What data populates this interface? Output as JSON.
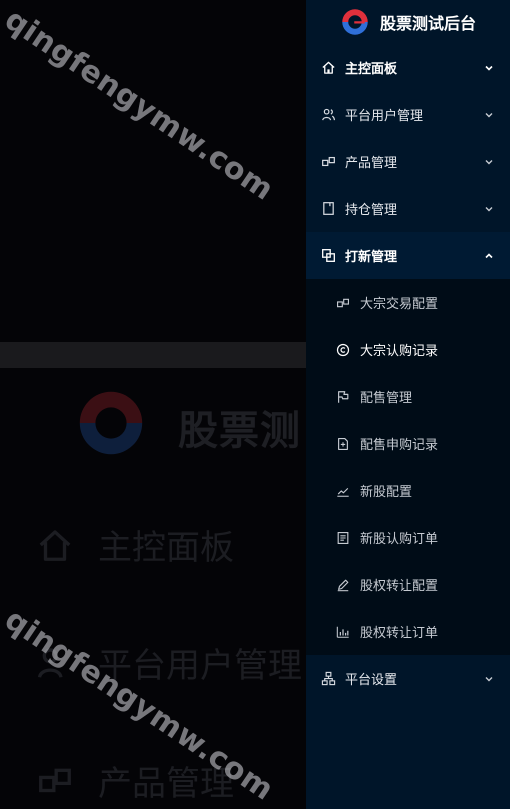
{
  "watermark": {
    "text1": "qingfengymw.com",
    "text2": "qingfengymw.com"
  },
  "background": {
    "title": "股票测",
    "items": [
      "主控面板",
      "平台用户管理",
      "产品管理"
    ]
  },
  "brand": {
    "title": "股票测试后台"
  },
  "menu": [
    {
      "label": "主控面板",
      "icon": "home-icon",
      "expanded": false
    },
    {
      "label": "平台用户管理",
      "icon": "users-icon",
      "expanded": false
    },
    {
      "label": "产品管理",
      "icon": "product-icon",
      "expanded": false
    },
    {
      "label": "持仓管理",
      "icon": "document-icon",
      "expanded": false
    },
    {
      "label": "打新管理",
      "icon": "ipo-icon",
      "expanded": true
    }
  ],
  "submenu": [
    {
      "label": "大宗交易配置",
      "icon": "product-icon"
    },
    {
      "label": "大宗认购记录",
      "icon": "copyright-icon",
      "active": true
    },
    {
      "label": "配售管理",
      "icon": "flag-icon"
    },
    {
      "label": "配售申购记录",
      "icon": "file-icon"
    },
    {
      "label": "新股配置",
      "icon": "line-chart-icon"
    },
    {
      "label": "新股认购订单",
      "icon": "receipt-icon"
    },
    {
      "label": "股权转让配置",
      "icon": "edit-icon"
    },
    {
      "label": "股权转让订单",
      "icon": "bar-chart-icon"
    }
  ],
  "bottom_menu": {
    "label": "平台设置",
    "icon": "cluster-icon",
    "expanded": false
  },
  "colors": {
    "sidebar_bg": "#001529",
    "submenu_bg": "#000c17",
    "logo_red": "#e0303c",
    "logo_blue": "#2f6fd8"
  }
}
